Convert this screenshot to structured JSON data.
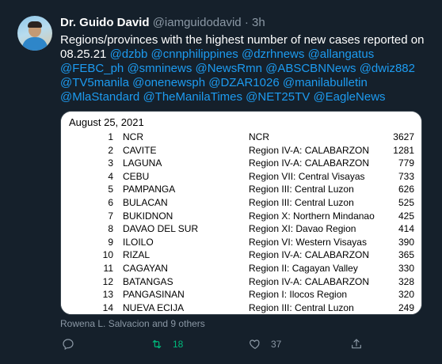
{
  "author": {
    "name": "Dr. Guido David",
    "handle": "@iamguidodavid",
    "separator": "·",
    "time": "3h"
  },
  "tweet": {
    "text": "Regions/provinces with the highest number of new cases reported on 08.25.21",
    "mentions": [
      "@dzbb",
      "@cnnphilippines",
      "@dzrhnews",
      "@allangatus",
      "@FEBC_ph",
      "@smninews",
      "@NewsRmn",
      "@ABSCBNNews",
      "@dwiz882",
      "@TV5manila",
      "@onenewsph",
      "@DZAR1026",
      "@manilabulletin",
      "@MlaStandard",
      "@TheManilaTimes",
      "@NET25TV",
      "@EagleNews"
    ]
  },
  "image": {
    "date": "August 25, 2021",
    "rows": [
      {
        "rank": "1",
        "province": "NCR",
        "region": "NCR",
        "cases": "3627"
      },
      {
        "rank": "2",
        "province": "CAVITE",
        "region": "Region IV-A: CALABARZON",
        "cases": "1281"
      },
      {
        "rank": "3",
        "province": "LAGUNA",
        "region": "Region IV-A: CALABARZON",
        "cases": "779"
      },
      {
        "rank": "4",
        "province": "CEBU",
        "region": "Region VII: Central Visayas",
        "cases": "733"
      },
      {
        "rank": "5",
        "province": "PAMPANGA",
        "region": "Region III: Central Luzon",
        "cases": "626"
      },
      {
        "rank": "6",
        "province": "BULACAN",
        "region": "Region III: Central Luzon",
        "cases": "525"
      },
      {
        "rank": "7",
        "province": "BUKIDNON",
        "region": "Region X: Northern Mindanao",
        "cases": "425"
      },
      {
        "rank": "8",
        "province": "DAVAO DEL SUR",
        "region": "Region XI: Davao Region",
        "cases": "414"
      },
      {
        "rank": "9",
        "province": "ILOILO",
        "region": "Region VI: Western Visayas",
        "cases": "390"
      },
      {
        "rank": "10",
        "province": "RIZAL",
        "region": "Region IV-A: CALABARZON",
        "cases": "365"
      },
      {
        "rank": "11",
        "province": "CAGAYAN",
        "region": "Region II: Cagayan Valley",
        "cases": "330"
      },
      {
        "rank": "12",
        "province": "BATANGAS",
        "region": "Region IV-A: CALABARZON",
        "cases": "328"
      },
      {
        "rank": "13",
        "province": "PANGASINAN",
        "region": "Region I: Ilocos Region",
        "cases": "320"
      },
      {
        "rank": "14",
        "province": "NUEVA ECIJA",
        "region": "Region III: Central Luzon",
        "cases": "249"
      }
    ]
  },
  "liked_by": "Rowena L. Salvacion and 9 others",
  "actions": {
    "reply": {
      "icon": "reply-icon"
    },
    "retweet": {
      "icon": "retweet-icon",
      "count": "18"
    },
    "like": {
      "icon": "heart-icon",
      "count": "37"
    },
    "share": {
      "icon": "share-icon"
    }
  },
  "colors": {
    "background": "#15202b",
    "link": "#1d9bf0",
    "muted": "#8b98a5",
    "retweet_active": "#00ba7c"
  }
}
